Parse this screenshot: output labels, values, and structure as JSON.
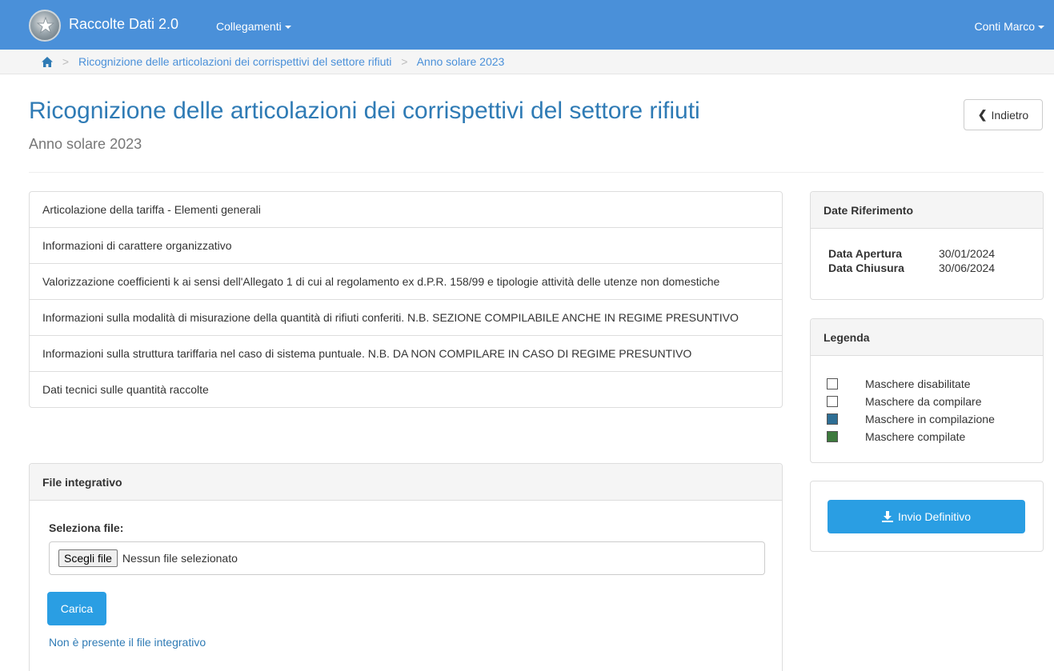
{
  "navbar": {
    "app_title": "Raccolte Dati 2.0",
    "links_label": "Collegamenti",
    "user_label": "Conti Marco"
  },
  "breadcrumb": {
    "items": [
      "Ricognizione delle articolazioni dei corrispettivi del settore rifiuti",
      "Anno solare 2023"
    ]
  },
  "header": {
    "title": "Ricognizione delle articolazioni dei corrispettivi del settore rifiuti",
    "subtitle": "Anno solare 2023",
    "back_label": "Indietro"
  },
  "sections": [
    "Articolazione della tariffa - Elementi generali",
    "Informazioni di carattere organizzativo",
    "Valorizzazione coefficienti k ai sensi dell'Allegato 1 di cui al regolamento ex d.P.R. 158/99 e tipologie attività delle utenze non domestiche",
    "Informazioni sulla modalità di misurazione della quantità di rifiuti conferiti. N.B. SEZIONE COMPILABILE ANCHE IN REGIME PRESUNTIVO",
    "Informazioni sulla struttura tariffaria nel caso di sistema puntuale. N.B. DA NON COMPILARE IN CASO DI REGIME PRESUNTIVO",
    "Dati tecnici sulle quantità raccolte"
  ],
  "file_panel": {
    "heading": "File integrativo",
    "select_label": "Seleziona file:",
    "choose_button": "Scegli file",
    "no_file_selected": "Nessun file selezionato",
    "upload_button": "Carica",
    "status_text": "Non è presente il file integrativo"
  },
  "dates_panel": {
    "heading": "Date Riferimento",
    "opening_label": "Data Apertura",
    "opening_value": "30/01/2024",
    "closing_label": "Data Chiusura",
    "closing_value": "30/06/2024"
  },
  "legend_panel": {
    "heading": "Legenda",
    "items": [
      {
        "label": "Maschere disabilitate",
        "color": "#ffffff"
      },
      {
        "label": "Maschere da compilare",
        "color": "#ffffff"
      },
      {
        "label": "Maschere in compilazione",
        "color": "#2e6e94"
      },
      {
        "label": "Maschere compilate",
        "color": "#3d7a3d"
      }
    ]
  },
  "send_panel": {
    "button_label": "Invio Definitivo"
  },
  "colors": {
    "navbar": "#4a90d9",
    "primary_button": "#2a9ee3",
    "title": "#2f7bb5"
  }
}
